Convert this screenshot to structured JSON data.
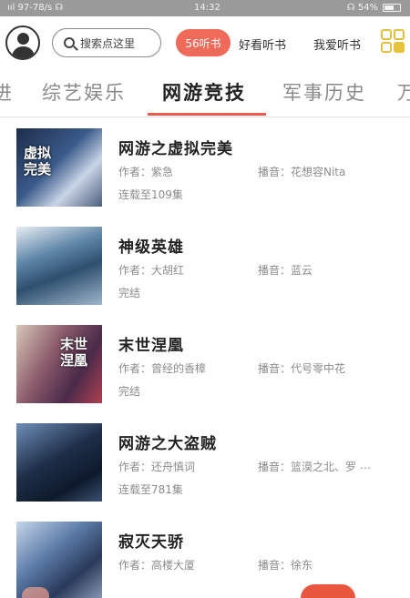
{
  "status_bar": {
    "left": "ııl 97-78/s ☊",
    "time": "14:32",
    "right": "☊ 54%"
  },
  "header": {
    "search_placeholder": "搜索点这里",
    "pill_label": "56听书",
    "links": [
      "好看听书",
      "我爱听书"
    ]
  },
  "tabs": [
    "进",
    "综艺娱乐",
    "网游竞技",
    "军事历史",
    "万"
  ],
  "active_tab": "网游竞技",
  "books": [
    {
      "title": "网游之虚拟完美",
      "author": "作者：紫急",
      "narrator": "播音：花想容Nita",
      "status": "连载至109集",
      "cover_text": "虚拟\n完美",
      "cover_color": "#2a3b5a"
    },
    {
      "title": "神级英雄",
      "author": "作者：大胡红",
      "narrator": "播音：蓝云",
      "status": "完结",
      "cover_text": "",
      "cover_color": "#4a6f8f"
    },
    {
      "title": "末世涅凰",
      "author": "作者：曾经的香樟",
      "narrator": "播音：代号零中花",
      "status": "完结",
      "cover_text": "末世\n涅凰",
      "cover_color": "#6a4a5a"
    },
    {
      "title": "网游之大盗贼",
      "author": "作者：还舟慎词",
      "narrator": "播音：篮漠之北、罗",
      "status": "连载至781集",
      "cover_text": "",
      "cover_color": "#243852"
    },
    {
      "title": "寂灭天骄",
      "author": "作者：高楼大厦",
      "narrator": "播音：徐东",
      "status": "",
      "cover_text": "",
      "cover_color": "#3a4a6a"
    }
  ],
  "more_indicator": "…",
  "colors": {
    "accent": "#e85a4c",
    "pill": "#f06a5a",
    "status_bar": "#9a9a9a"
  }
}
